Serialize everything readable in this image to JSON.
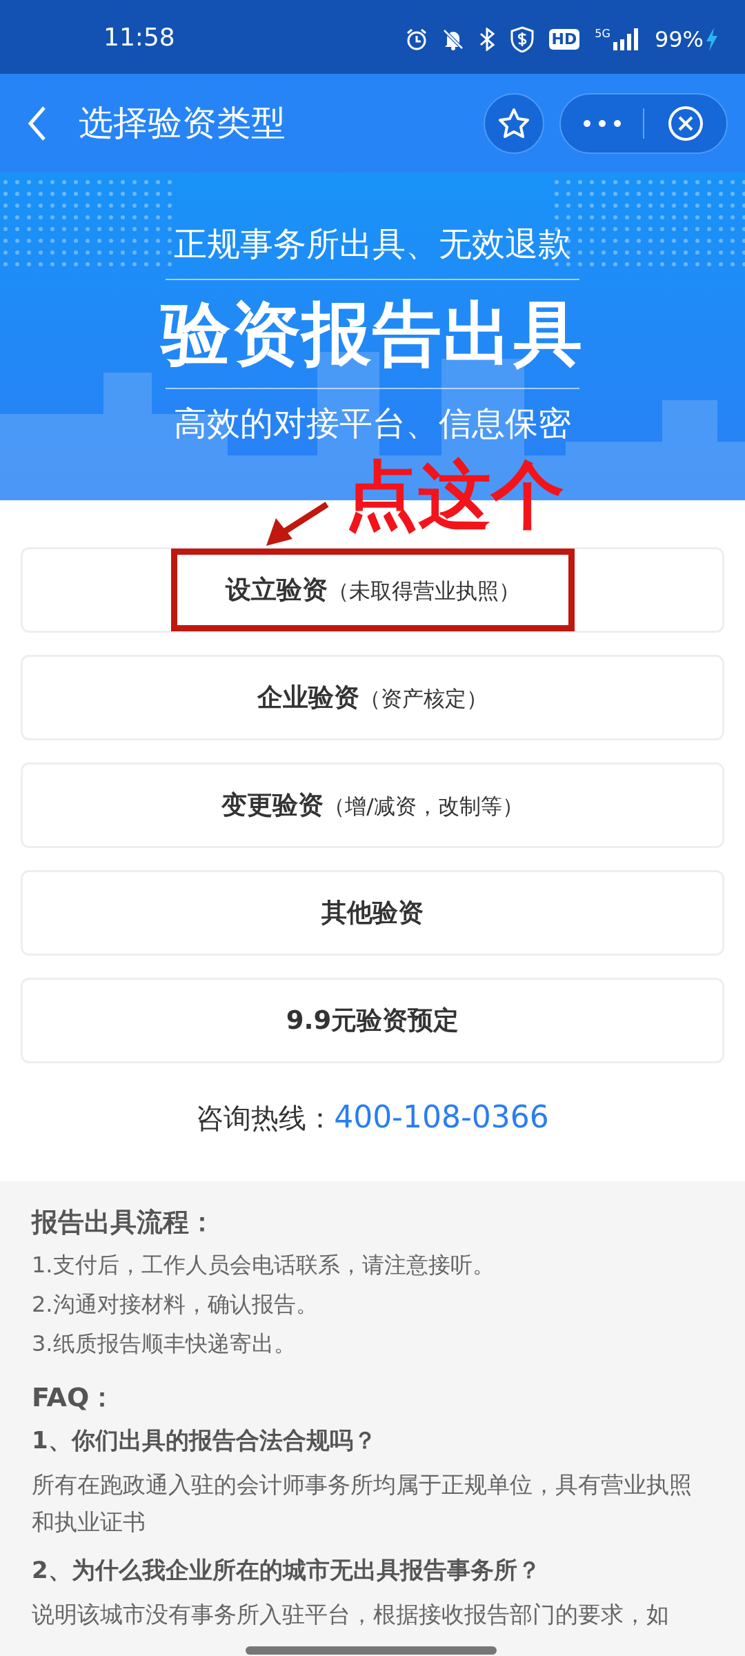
{
  "status_bar": {
    "time": "11:58",
    "network": "5G",
    "hd": "HD",
    "battery": "99%"
  },
  "header": {
    "title": "选择验资类型"
  },
  "banner": {
    "tagline": "正规事务所出具、无效退款",
    "headline": "验资报告出具",
    "subline": "高效的对接平台、信息保密"
  },
  "annotation": {
    "text": "点这个"
  },
  "options": [
    {
      "title": "设立验资",
      "note": "（未取得营业执照）",
      "highlighted": true
    },
    {
      "title": "企业验资",
      "note": "（资产核定）",
      "highlighted": false
    },
    {
      "title": "变更验资",
      "note": "（增/减资，改制等）",
      "highlighted": false
    },
    {
      "title": "其他验资",
      "highlighted": false
    },
    {
      "title": "9.9元验资预定",
      "highlighted": false
    }
  ],
  "hotline": {
    "label": "咨询热线：",
    "number": "400-108-0366"
  },
  "process": {
    "title": "报告出具流程：",
    "steps": [
      "1.支付后，工作人员会电话联系，请注意接听。",
      "2.沟通对接材料，确认报告。",
      "3.纸质报告顺丰快递寄出。"
    ]
  },
  "faq": {
    "title": "FAQ：",
    "items": [
      {
        "question": "1、你们出具的报告合法合规吗？",
        "answer": "所有在跑政通入驻的会计师事务所均属于正规单位，具有营业执照和执业证书"
      },
      {
        "question": "2、为什么我企业所在的城市无出具报告事务所？",
        "answer": "说明该城市没有事务所入驻平台，根据接收报告部门的要求，如"
      }
    ]
  }
}
